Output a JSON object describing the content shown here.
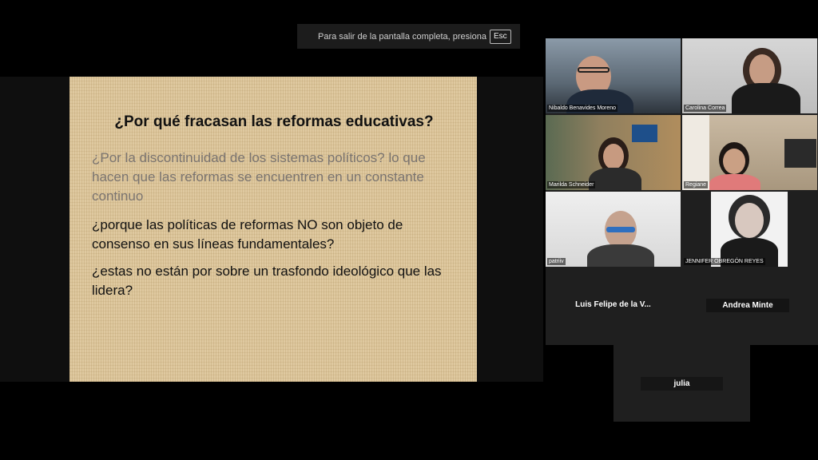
{
  "banner": {
    "text": "Para salir de la pantalla completa, presiona",
    "key": "Esc"
  },
  "slide": {
    "title": "¿Por qué fracasan las reformas educativas?",
    "paragraphs": [
      "¿Por la discontinuidad de los sistemas políticos? lo que hacen que las reformas se encuentren en un constante continuo",
      "¿porque las políticas de reformas  NO son objeto de consenso  en sus líneas fundamentales?",
      "¿estas no están por sobre un trasfondo ideológico que las lidera?"
    ]
  },
  "participants": [
    {
      "name": "Nibaldo Benavides Moreno"
    },
    {
      "name": "Carolina Correa"
    },
    {
      "name": "Marilda Schneider"
    },
    {
      "name": "Regiane"
    },
    {
      "name": "patriiv"
    },
    {
      "name": "JENNIFER OBREGÓN REYES"
    },
    {
      "name": "Luis Felipe de la V..."
    },
    {
      "name": "Andrea Minte"
    },
    {
      "name": "julia"
    }
  ],
  "colors": {
    "slide_bg": "#dcc497",
    "gallery_bg": "#1f1f1f",
    "gray_text": "#7a7470"
  }
}
